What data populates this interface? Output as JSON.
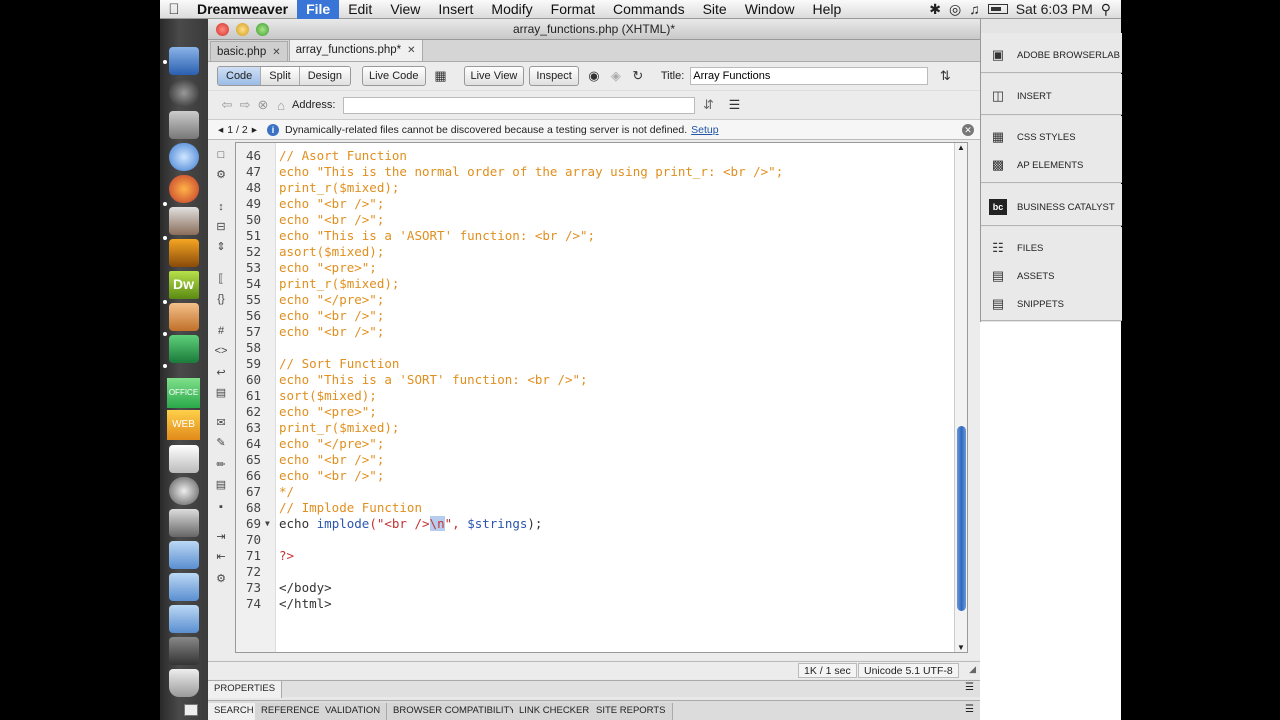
{
  "menubar": {
    "app_name": "Dreamweaver",
    "items": [
      "File",
      "Edit",
      "View",
      "Insert",
      "Modify",
      "Format",
      "Commands",
      "Site",
      "Window",
      "Help"
    ],
    "clock": "Sat 6:03 PM"
  },
  "dock": {
    "labels": [
      "Dw",
      "OFFICE",
      "WEB"
    ]
  },
  "window": {
    "title": "array_functions.php (XHTML)*",
    "tabs": [
      {
        "label": "basic.php",
        "close": "✕"
      },
      {
        "label": "array_functions.php*",
        "close": "✕"
      }
    ]
  },
  "toolbar": {
    "view_modes": [
      "Code",
      "Split",
      "Design"
    ],
    "live_code": "Live Code",
    "live_view": "Live View",
    "inspect": "Inspect",
    "title_label": "Title:",
    "title_value": "Array Functions"
  },
  "browser_nav": {
    "address_label": "Address:",
    "address_value": ""
  },
  "infobar": {
    "pager": "1 / 2",
    "message": "Dynamically-related files cannot be discovered because a testing server is not defined.",
    "link": "Setup"
  },
  "code": {
    "lines": [
      {
        "n": "46",
        "t": "// Asort Function"
      },
      {
        "n": "47",
        "t": "echo \"This is the normal order of the array using print_r: <br />\";"
      },
      {
        "n": "48",
        "t": "print_r($mixed);"
      },
      {
        "n": "49",
        "t": "echo \"<br />\";"
      },
      {
        "n": "50",
        "t": "echo \"<br />\";"
      },
      {
        "n": "51",
        "t": "echo \"This is a 'ASORT' function: <br />\";"
      },
      {
        "n": "52",
        "t": "asort($mixed);"
      },
      {
        "n": "53",
        "t": "echo \"<pre>\";"
      },
      {
        "n": "54",
        "t": "print_r($mixed);"
      },
      {
        "n": "55",
        "t": "echo \"</pre>\";"
      },
      {
        "n": "56",
        "t": "echo \"<br />\";"
      },
      {
        "n": "57",
        "t": "echo \"<br />\";"
      },
      {
        "n": "58",
        "t": ""
      },
      {
        "n": "59",
        "t": "// Sort Function"
      },
      {
        "n": "60",
        "t": "echo \"This is a 'SORT' function: <br />\";"
      },
      {
        "n": "61",
        "t": "sort($mixed);"
      },
      {
        "n": "62",
        "t": "echo \"<pre>\";"
      },
      {
        "n": "63",
        "t": "print_r($mixed);"
      },
      {
        "n": "64",
        "t": "echo \"</pre>\";"
      },
      {
        "n": "65",
        "t": "echo \"<br />\";"
      },
      {
        "n": "66",
        "t": "echo \"<br />\";"
      },
      {
        "n": "67",
        "t": "*/"
      },
      {
        "n": "68",
        "t": "// Implode Function"
      },
      {
        "n": "69",
        "t": "echo implode(\"<br />\\n\", $strings);"
      },
      {
        "n": "70",
        "t": ""
      },
      {
        "n": "71",
        "t": "?>"
      },
      {
        "n": "72",
        "t": ""
      },
      {
        "n": "73",
        "t": "</body>"
      },
      {
        "n": "74",
        "t": "</html>"
      }
    ],
    "line69": {
      "echo": "echo",
      "fn": "implode",
      "open": "(\"<br />",
      "selected": "\\n",
      "close": "\", ",
      "var": "$strings",
      "end": ");"
    }
  },
  "status": {
    "size": "1K / 1 sec",
    "encoding": "Unicode 5.1 UTF-8"
  },
  "properties": {
    "tab": "PROPERTIES"
  },
  "results_tabs": [
    "SEARCH",
    "REFERENCE",
    "VALIDATION",
    "BROWSER COMPATIBILITY",
    "LINK CHECKER",
    "SITE REPORTS"
  ],
  "panel": {
    "items": [
      "ADOBE BROWSERLAB",
      "INSERT",
      "CSS STYLES",
      "AP ELEMENTS",
      "BUSINESS CATALYST",
      "FILES",
      "ASSETS",
      "SNIPPETS"
    ]
  },
  "colors": {
    "comment_orange": "#e08f1e",
    "string_red": "#c43232",
    "keyword_blue": "#2a55b0",
    "selection": "#b6cdf0",
    "menu_highlight": "#3875d7"
  }
}
